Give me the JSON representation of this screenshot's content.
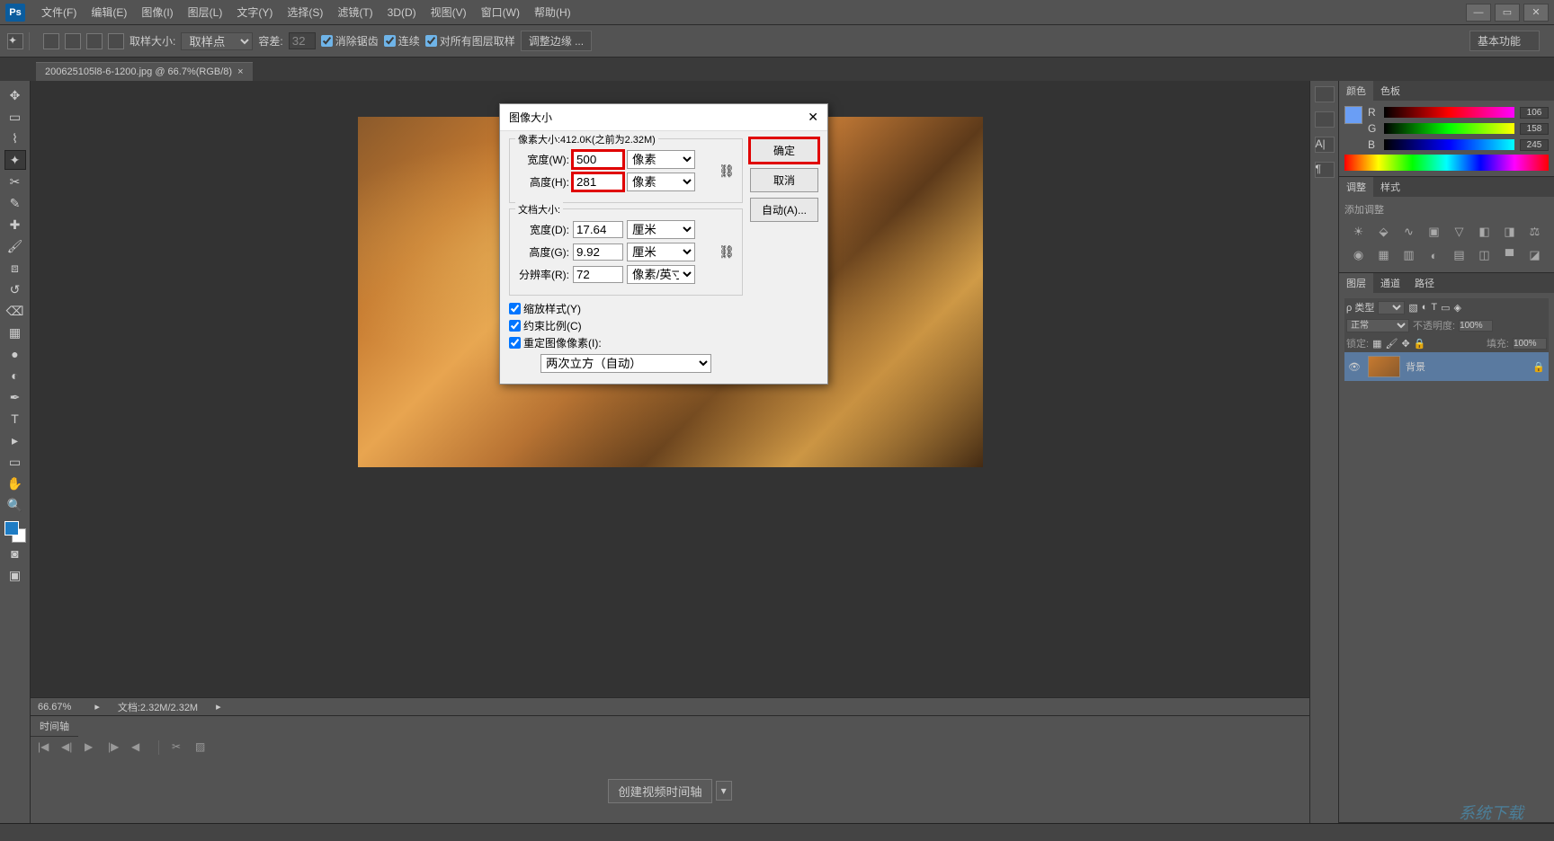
{
  "app": {
    "logo": "Ps"
  },
  "menu": [
    "文件(F)",
    "编辑(E)",
    "图像(I)",
    "图层(L)",
    "文字(Y)",
    "选择(S)",
    "滤镜(T)",
    "3D(D)",
    "视图(V)",
    "窗口(W)",
    "帮助(H)"
  ],
  "window_controls": {
    "min": "—",
    "max": "▭",
    "close": "✕"
  },
  "options": {
    "sample_label": "取样大小:",
    "sample_value": "取样点",
    "tolerance_label": "容差:",
    "tolerance_value": "32",
    "antialias": "消除锯齿",
    "contiguous": "连续",
    "all_layers": "对所有图层取样",
    "refine_edge": "调整边缘 ...",
    "workspace": "基本功能"
  },
  "document": {
    "tab": "200625105l8-6-1200.jpg @ 66.7%(RGB/8)",
    "tab_close": "×"
  },
  "status": {
    "zoom": "66.67%",
    "doc_size": "文档:2.32M/2.32M"
  },
  "timeline": {
    "tab": "时间轴",
    "create_button": "创建视频时间轴"
  },
  "color_panel": {
    "tabs": [
      "颜色",
      "色板"
    ],
    "r": {
      "label": "R",
      "value": "106"
    },
    "g": {
      "label": "G",
      "value": "158"
    },
    "b": {
      "label": "B",
      "value": "245"
    }
  },
  "adjust_panel": {
    "tabs": [
      "调整",
      "样式"
    ],
    "hint": "添加调整"
  },
  "layers_panel": {
    "tabs": [
      "图层",
      "通道",
      "路径"
    ],
    "type_label": "ρ 类型",
    "mode": "正常",
    "opacity_label": "不透明度:",
    "opacity": "100%",
    "lock_label": "锁定:",
    "fill_label": "填充:",
    "fill": "100%",
    "layer_name": "背景",
    "eye": "👁",
    "lock_icon": "🔒"
  },
  "dialog": {
    "title": "图像大小",
    "pixel_size_label": "像素大小:412.0K(之前为2.32M)",
    "width_label": "宽度(W):",
    "width_value": "500",
    "height_label": "高度(H):",
    "height_value": "281",
    "unit_px": "像素",
    "doc_size_label": "文档大小:",
    "doc_width_label": "宽度(D):",
    "doc_width_value": "17.64",
    "doc_height_label": "高度(G):",
    "doc_height_value": "9.92",
    "unit_cm": "厘米",
    "resolution_label": "分辨率(R):",
    "resolution_value": "72",
    "unit_res": "像素/英寸",
    "scale_styles": "缩放样式(Y)",
    "constrain": "约束比例(C)",
    "resample": "重定图像像素(I):",
    "resample_method": "两次立方（自动）",
    "ok": "确定",
    "cancel": "取消",
    "auto": "自动(A)...",
    "link": "⛓",
    "close": "✕"
  },
  "watermark": "系统下载"
}
